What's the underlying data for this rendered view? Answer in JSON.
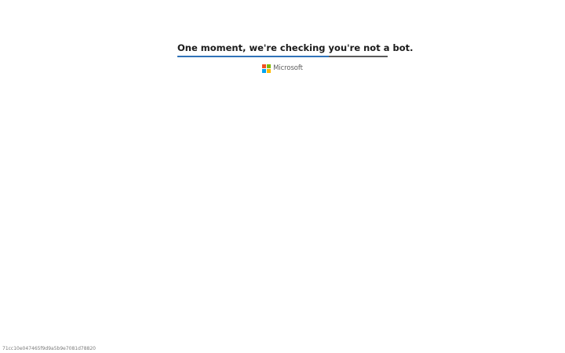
{
  "challenge": {
    "heading": "One moment, we're checking you're not a bot.",
    "progress_fraction": 0.72
  },
  "brand": {
    "name": "Microsoft",
    "logo_icon": "microsoft-logo-icon",
    "logo_colors": [
      "#f25022",
      "#7fba00",
      "#00a4ef",
      "#ffb900"
    ],
    "accent_color": "#2f72b8"
  },
  "footer": {
    "request_id": "71cc10e047465f9d9a5b9e7081d78820"
  }
}
